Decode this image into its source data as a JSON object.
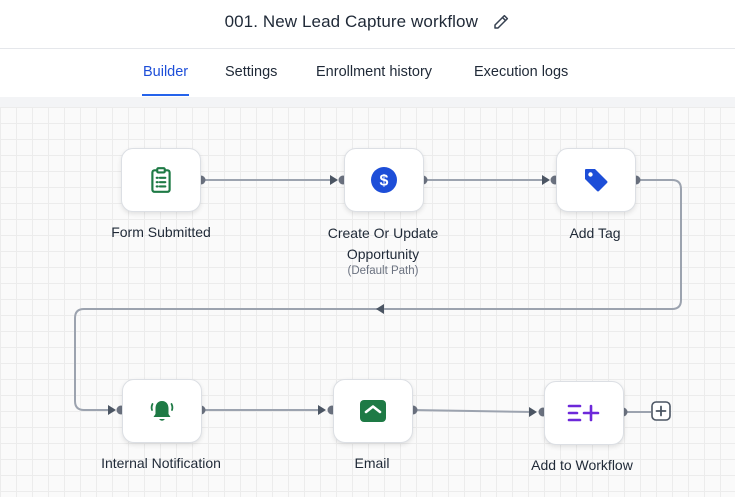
{
  "workflow": {
    "title": "001. New Lead Capture workflow"
  },
  "tabs": [
    {
      "label": "Builder",
      "active": true
    },
    {
      "label": "Settings"
    },
    {
      "label": "Enrollment history"
    },
    {
      "label": "Execution logs"
    }
  ],
  "nodes": [
    {
      "label": "Form Submitted",
      "icon": "clipboard-icon",
      "color": "#1e7a45"
    },
    {
      "label_line1": "Create Or Update",
      "label_line2": "Opportunity",
      "sublabel": "(Default Path)",
      "icon": "dollar-icon",
      "color": "#1d4ed8"
    },
    {
      "label": "Add Tag",
      "icon": "tag-icon",
      "color": "#1d4ed8"
    },
    {
      "label": "Internal Notification",
      "icon": "bell-icon",
      "color": "#1e7a45"
    },
    {
      "label": "Email",
      "icon": "envelope-icon",
      "color": "#1e7a45"
    },
    {
      "label": "Add to Workflow",
      "icon": "list-add-icon",
      "color": "#6d28d9"
    }
  ],
  "colors": {
    "accent": "#2563eb",
    "connector": "#9ca3af",
    "port": "#6b7280"
  }
}
